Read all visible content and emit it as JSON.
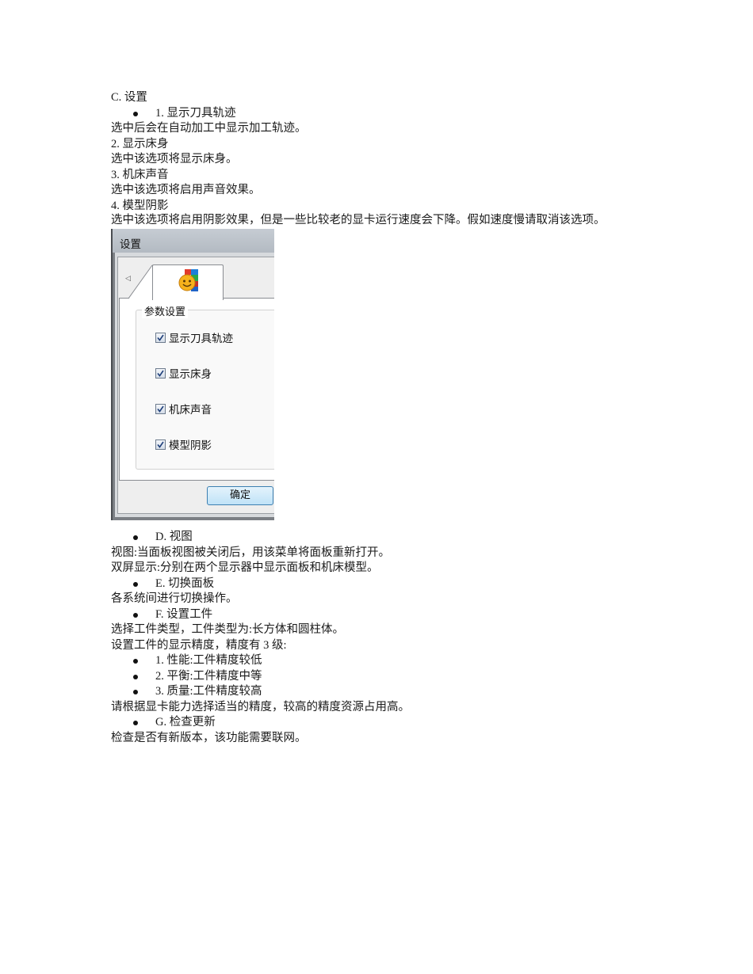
{
  "section_c": {
    "heading": "C. 设置",
    "item1_bullet": "1. 显示刀具轨迹",
    "item1_desc": "选中后会在自动加工中显示加工轨迹。",
    "item2_title": "2. 显示床身",
    "item2_desc": "选中该选项将显示床身。",
    "item3_title": "3. 机床声音",
    "item3_desc": "选中该选项将启用声音效果。",
    "item4_title": "4. 模型阴影",
    "item4_desc": "选中该选项将启用阴影效果，但是一些比较老的显卡运行速度会下降。假如速度慢请取消该选项。"
  },
  "dialog": {
    "title": "设置",
    "group_label": "参数设置",
    "checkboxes": [
      {
        "label": "显示刀具轨迹",
        "checked": true
      },
      {
        "label": "显示床身",
        "checked": true
      },
      {
        "label": "机床声音",
        "checked": true
      },
      {
        "label": "模型阴影",
        "checked": true
      }
    ],
    "ok_label": "确定",
    "tab_icon": "settings-face-icon"
  },
  "section_d": {
    "bullet": "D. 视图",
    "line1": "视图:当面板视图被关闭后，用该菜单将面板重新打开。",
    "line2": "双屏显示:分别在两个显示器中显示面板和机床模型。"
  },
  "section_e": {
    "bullet": "E. 切换面板",
    "line1": "各系统间进行切换操作。"
  },
  "section_f": {
    "bullet": "F. 设置工件",
    "line1": "选择工件类型，工件类型为:长方体和圆柱体。",
    "line2": "设置工件的显示精度，精度有 3 级:",
    "levels": [
      "1. 性能:工件精度较低",
      "2. 平衡:工件精度中等",
      "3. 质量:工件精度较高"
    ],
    "line3": "请根据显卡能力选择适当的精度，较高的精度资源占用高。"
  },
  "section_g": {
    "bullet": "G. 检查更新",
    "line1": "检查是否有新版本，该功能需要联网。"
  }
}
